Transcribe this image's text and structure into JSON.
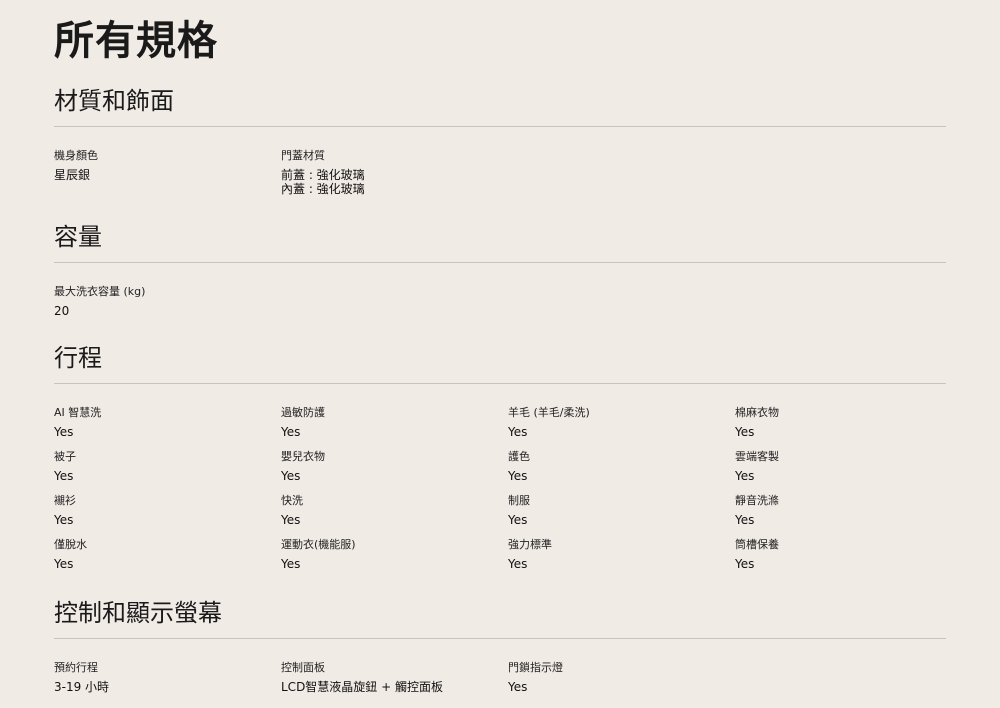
{
  "page_title": "所有規格",
  "sections": [
    {
      "title": "材質和飾面",
      "items": [
        {
          "label": "機身顏色",
          "value": [
            "星辰銀"
          ]
        },
        {
          "label": "門蓋材質",
          "value": [
            "前蓋 : 強化玻璃",
            "內蓋 : 強化玻璃"
          ]
        }
      ]
    },
    {
      "title": "容量",
      "items": [
        {
          "label": "最大洗衣容量 (kg)",
          "value": [
            "20"
          ]
        }
      ]
    },
    {
      "title": "行程",
      "items": [
        {
          "label": "AI 智慧洗",
          "value": [
            "Yes"
          ]
        },
        {
          "label": "過敏防護",
          "value": [
            "Yes"
          ]
        },
        {
          "label": "羊毛 (羊毛/柔洗)",
          "value": [
            "Yes"
          ]
        },
        {
          "label": "棉麻衣物",
          "value": [
            "Yes"
          ]
        },
        {
          "label": "被子",
          "value": [
            "Yes"
          ]
        },
        {
          "label": "嬰兒衣物",
          "value": [
            "Yes"
          ]
        },
        {
          "label": "護色",
          "value": [
            "Yes"
          ]
        },
        {
          "label": "雲端客製",
          "value": [
            "Yes"
          ]
        },
        {
          "label": "襯衫",
          "value": [
            "Yes"
          ]
        },
        {
          "label": "快洗",
          "value": [
            "Yes"
          ]
        },
        {
          "label": "制服",
          "value": [
            "Yes"
          ]
        },
        {
          "label": "靜音洗滌",
          "value": [
            "Yes"
          ]
        },
        {
          "label": "僅脫水",
          "value": [
            "Yes"
          ]
        },
        {
          "label": "運動衣(機能服)",
          "value": [
            "Yes"
          ]
        },
        {
          "label": "強力標準",
          "value": [
            "Yes"
          ]
        },
        {
          "label": "筒槽保養",
          "value": [
            "Yes"
          ]
        }
      ]
    },
    {
      "title": "控制和顯示螢幕",
      "items": [
        {
          "label": "預約行程",
          "value": [
            "3-19 小時"
          ]
        },
        {
          "label": "控制面板",
          "value": [
            "LCD智慧液晶旋鈕 + 觸控面板"
          ]
        },
        {
          "label": "門鎖指示燈",
          "value": [
            "Yes"
          ]
        }
      ]
    }
  ],
  "colors": {
    "background": "#f1ebe5",
    "text": "#1a1a1a",
    "divider": "#c9c3bd"
  }
}
